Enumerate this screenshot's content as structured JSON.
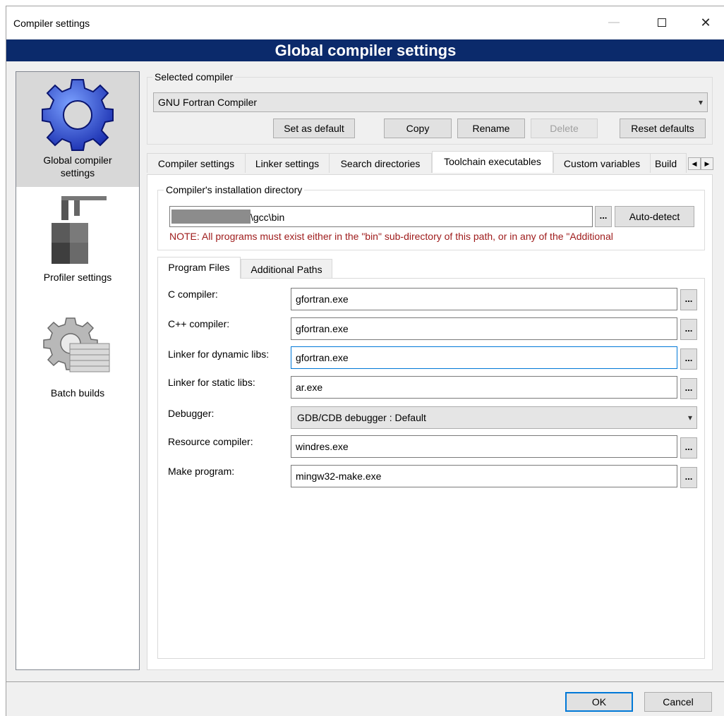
{
  "window": {
    "title": "Compiler settings",
    "minimize_icon": "minimize-icon",
    "maximize_icon": "maximize-icon",
    "close_glyph": "✕"
  },
  "banner": {
    "title": "Global compiler settings"
  },
  "left_nav": {
    "items": [
      {
        "label": "Global compiler settings",
        "icon": "gear-icon",
        "selected": true
      },
      {
        "label": "Profiler settings",
        "icon": "caliper-icon",
        "selected": false
      },
      {
        "label": "Batch builds",
        "icon": "gear-stack-icon",
        "selected": false
      }
    ]
  },
  "selected_compiler": {
    "group_label": "Selected compiler",
    "value": "GNU Fortran Compiler",
    "buttons": {
      "set_default": "Set as default",
      "copy": "Copy",
      "rename": "Rename",
      "delete": "Delete",
      "reset_defaults": "Reset defaults"
    }
  },
  "tabs": [
    {
      "label": "Compiler settings",
      "active": false
    },
    {
      "label": "Linker settings",
      "active": false
    },
    {
      "label": "Search directories",
      "active": false
    },
    {
      "label": "Toolchain executables",
      "active": true
    },
    {
      "label": "Custom variables",
      "active": false
    },
    {
      "label": "Build",
      "active": false
    }
  ],
  "install_dir": {
    "group_label": "Compiler's installation directory",
    "path_visible": "\\gcc\\bin",
    "browse_label": "...",
    "autodetect_label": "Auto-detect",
    "note": "NOTE: All programs must exist either in the \"bin\" sub-directory of this path, or in any of the \"Additional"
  },
  "subtabs": [
    {
      "label": "Program Files",
      "active": true
    },
    {
      "label": "Additional Paths",
      "active": false
    }
  ],
  "programs": [
    {
      "label": "C compiler:",
      "value": "gfortran.exe"
    },
    {
      "label": "C++ compiler:",
      "value": "gfortran.exe"
    },
    {
      "label": "Linker for dynamic libs:",
      "value": "gfortran.exe"
    },
    {
      "label": "Linker for static libs:",
      "value": "ar.exe"
    },
    {
      "label": "Debugger:",
      "value": "GDB/CDB debugger : Default"
    },
    {
      "label": "Resource compiler:",
      "value": "windres.exe"
    },
    {
      "label": "Make program:",
      "value": "mingw32-make.exe"
    }
  ],
  "browse_label": "...",
  "footer": {
    "ok": "OK",
    "cancel": "Cancel"
  }
}
